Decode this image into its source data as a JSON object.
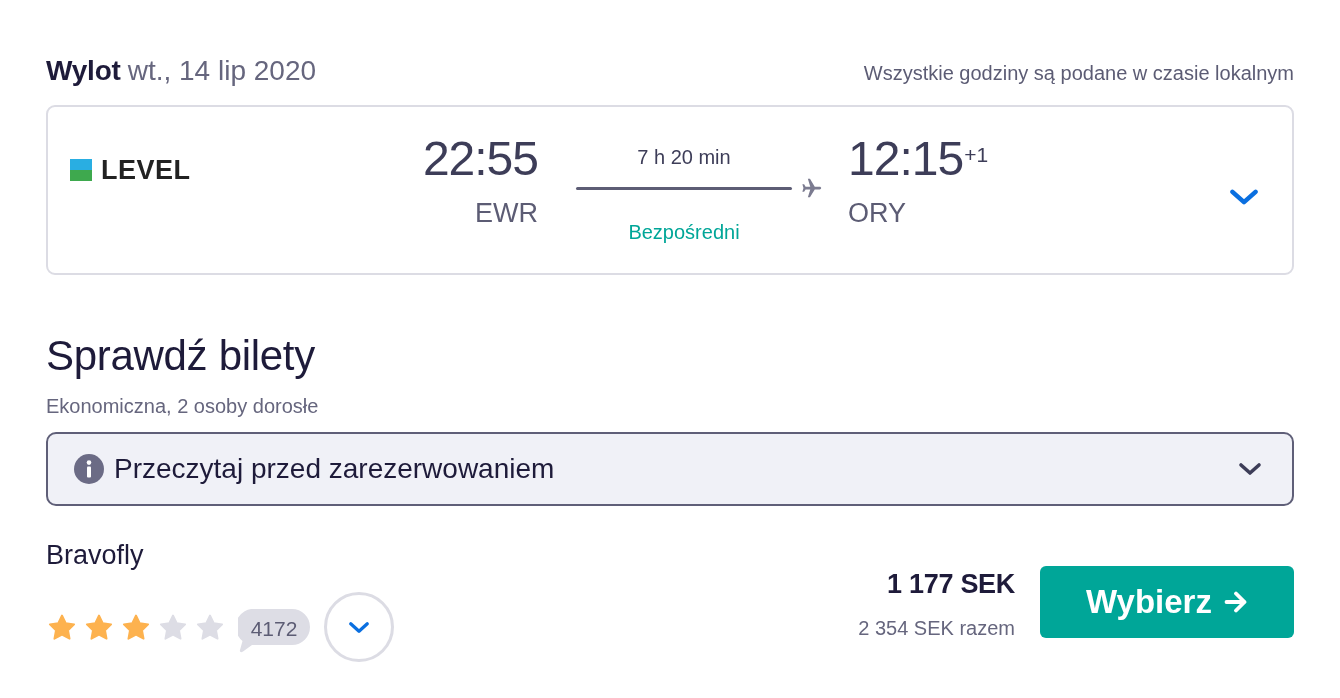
{
  "header": {
    "label": "Wylot",
    "date": "wt., 14 lip 2020",
    "note": "Wszystkie godziny są podane w czasie lokalnym"
  },
  "flight": {
    "airline_logo": "LEVEL",
    "departure": {
      "time": "22:55",
      "airport": "EWR"
    },
    "duration": "7 h 20 min",
    "stops": "Bezpośredni",
    "arrival": {
      "time": "12:15",
      "day_offset": "+1",
      "airport": "ORY"
    },
    "expanded": false
  },
  "tickets": {
    "title": "Sprawdź bilety",
    "subtitle": "Ekonomiczna, 2 osoby dorosłe"
  },
  "notice": {
    "text": "Przeczytaj przed zarezerwowaniem",
    "expanded": false
  },
  "offers": [
    {
      "provider": "Bravofly",
      "stars": 3,
      "reviews": "4172",
      "expanded": false,
      "price": "1 177 SEK",
      "total": "2 354 SEK razem",
      "button": "Wybierz"
    }
  ]
}
